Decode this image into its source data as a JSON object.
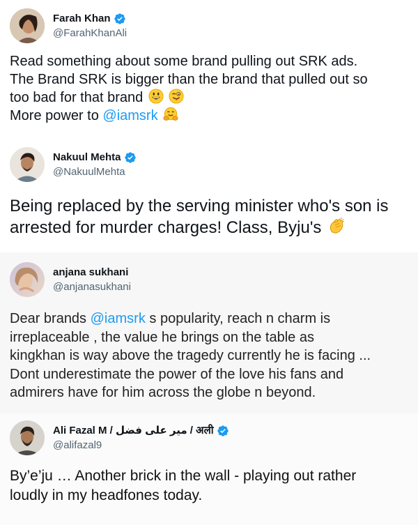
{
  "tweets": [
    {
      "name": "Farah Khan",
      "handle": "@FarahKhanAli",
      "verified": true,
      "lines": [
        {
          "text": "Read something about some brand pulling out SRK ads."
        },
        {
          "text": "The Brand SRK is bigger than the brand that pulled out so"
        },
        {
          "text": "too bad for that brand",
          "emoji": [
            "grinning-face-emoji",
            "winking-tongue-face-emoji"
          ]
        },
        {
          "pre": "More power to ",
          "mention": "@iamsrk",
          "emoji": [
            "hugging-face-emoji"
          ]
        }
      ]
    },
    {
      "name": "Nakuul Mehta",
      "handle": "@NakuulMehta",
      "verified": true,
      "lines": [
        {
          "text": "Being replaced by the serving minister who's son is"
        },
        {
          "text": "arrested for murder charges! Class, Byju's",
          "emoji": [
            "clapping-hands-emoji"
          ]
        }
      ]
    },
    {
      "name": "anjana sukhani",
      "handle": "@anjanasukhani",
      "verified": false,
      "lines": [
        {
          "pre": "Dear brands ",
          "mention": "@iamsrk",
          "post": " s popularity, reach n charm is"
        },
        {
          "text": "irreplaceable , the value he brings on the table as"
        },
        {
          "text": "kingkhan is way above the tragedy currently he is facing ..."
        },
        {
          "text": "Dont underestimate the power of the love his fans and"
        },
        {
          "text": "admirers have for him across the globe n beyond."
        }
      ]
    },
    {
      "name": "Ali Fazal M / میر علی فضل / अली",
      "handle": "@alifazal9",
      "verified": true,
      "lines": [
        {
          "text": "By’e’ju   … Another brick in the wall - playing out rather"
        },
        {
          "text": "loudly in my headfones today."
        }
      ]
    }
  ],
  "colors": {
    "verified": "#1d9bf0",
    "mention": "#1d9bf0",
    "handle": "#536471"
  }
}
